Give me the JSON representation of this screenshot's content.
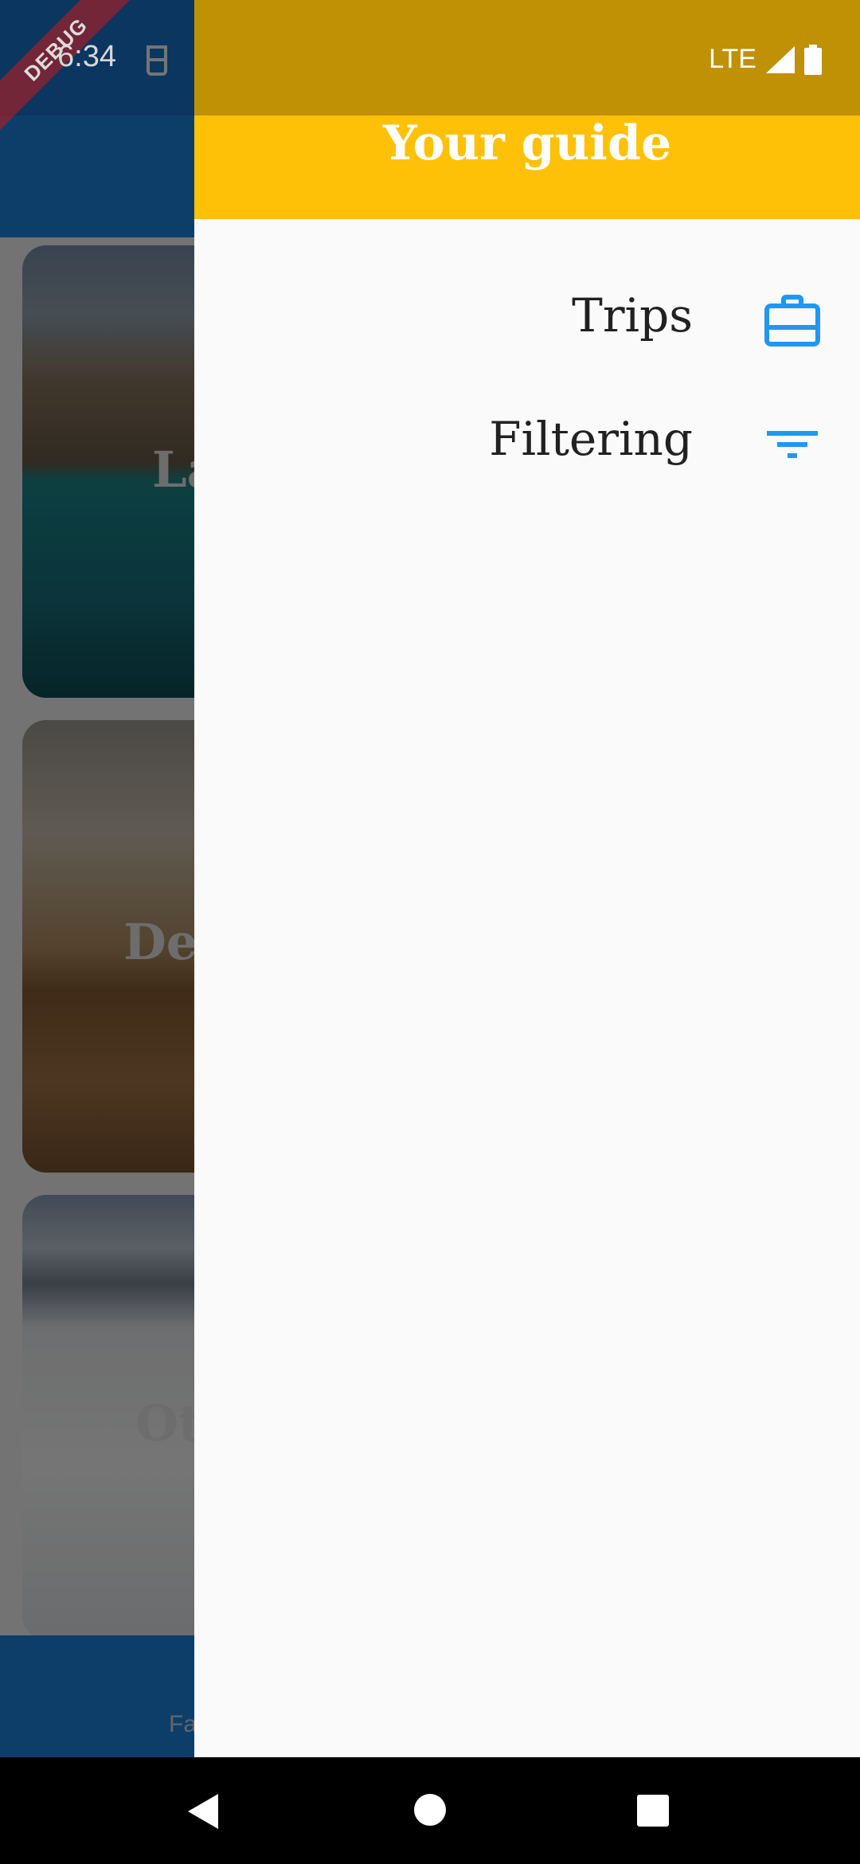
{
  "status_bar": {
    "time": "6:34",
    "network": "LTE",
    "debug_banner": "DEBUG"
  },
  "cards": [
    {
      "title": "La"
    },
    {
      "title": "De"
    },
    {
      "title": "Ot"
    }
  ],
  "bottom_nav": {
    "partial_label": "Fa"
  },
  "drawer": {
    "title": "Your guide",
    "items": [
      {
        "label": "Trips",
        "icon": "briefcase-icon"
      },
      {
        "label": "Filtering",
        "icon": "filter-icon"
      }
    ],
    "accent_color": "#2196f3",
    "header_color": "#ffc107"
  }
}
